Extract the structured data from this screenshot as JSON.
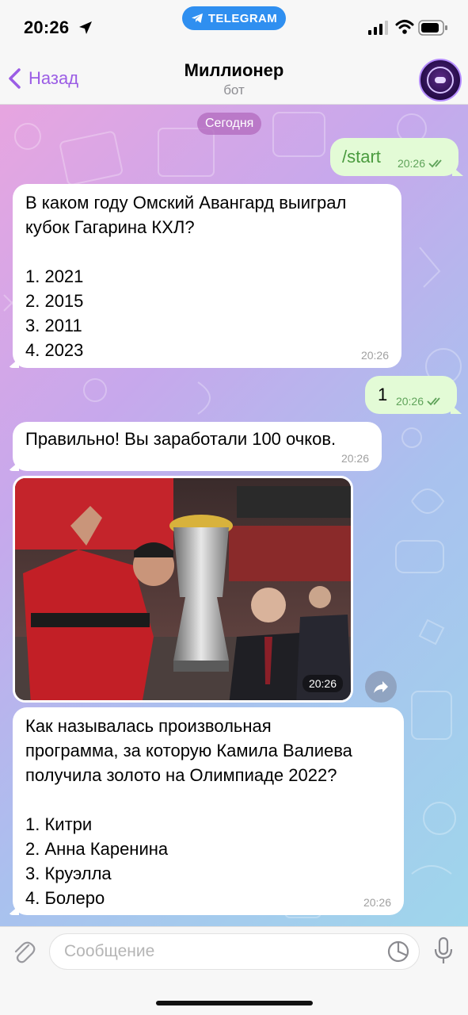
{
  "status": {
    "time": "20:26",
    "pill_label": "TELEGRAM"
  },
  "nav": {
    "back_label": "Назад",
    "title": "Миллионер",
    "subtitle": "бот"
  },
  "chat": {
    "date_chip": "Сегодня",
    "messages": [
      {
        "text": "/start",
        "time": "20:26"
      },
      {
        "text": "В каком году Омский Авангард выиграл\nкубок Гагарина КХЛ?\n\n1. 2021\n2. 2015\n3. 2011\n4. 2023",
        "time": "20:26"
      },
      {
        "text": "1",
        "time": "20:26"
      },
      {
        "text": "Правильно! Вы заработали 100 очков.",
        "time": "20:26"
      },
      {
        "time": "20:26"
      },
      {
        "text": "Как называлась произвольная\nпрограмма, за которую Камила Валиева\nполучила золото на Олимпиаде 2022?\n\n1. Китри\n2. Анна Каренина\n3. Круэлла\n4. Болеро",
        "time": "20:26"
      }
    ]
  },
  "input": {
    "placeholder": "Сообщение",
    "value": ""
  },
  "colors": {
    "accent": "#9b5de5",
    "outgoing_bubble": "#e3fbd6",
    "incoming_bubble": "#ffffff",
    "telegram_blue": "#2f8ff0"
  }
}
